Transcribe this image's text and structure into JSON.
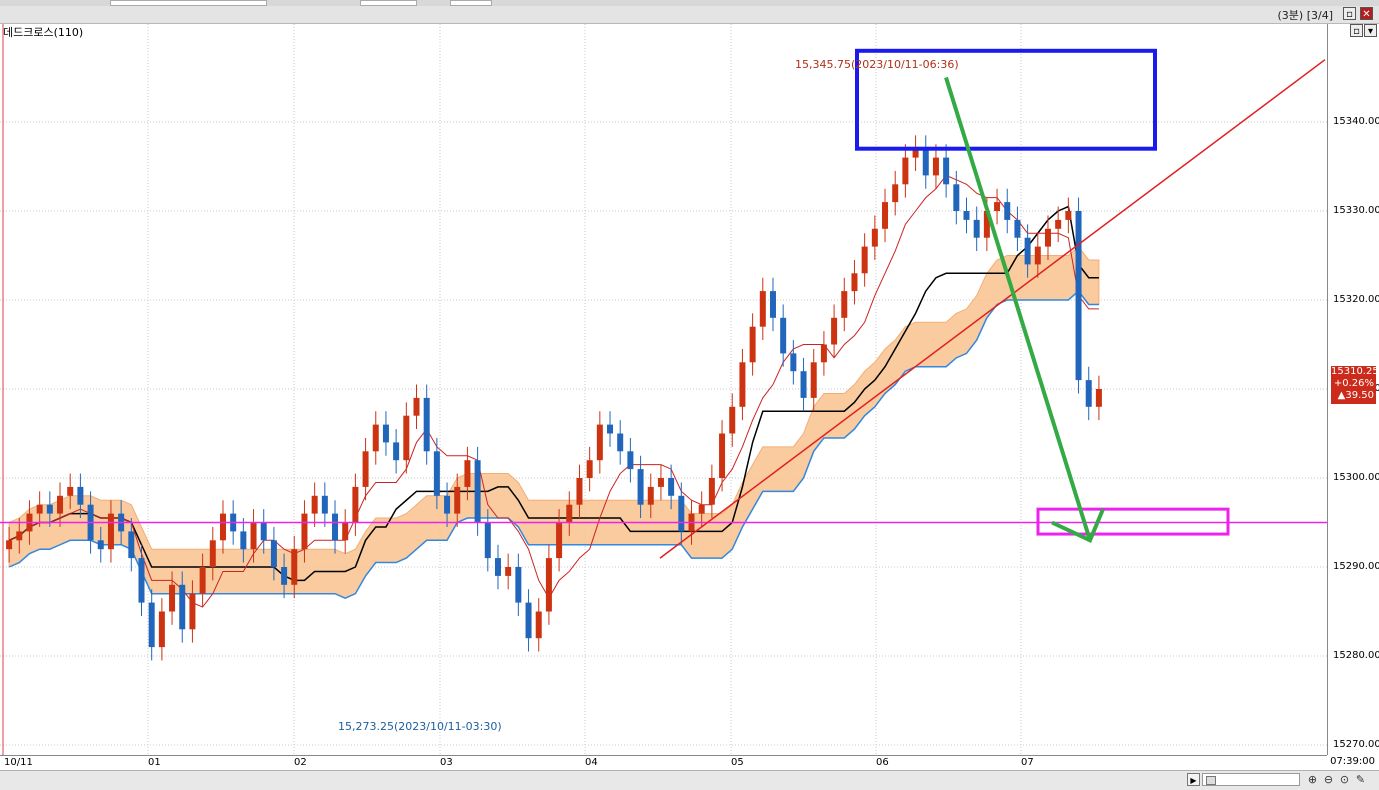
{
  "window": {
    "title": "(3분) [3/4]",
    "restore_glyph": "▫",
    "close_glyph": "✕"
  },
  "chart_data": {
    "type": "candlestick",
    "indicator_label": "데드크로스(110)",
    "y_ticks": [
      "15270.00",
      "15280.00",
      "15290.00",
      "15300.00",
      "15310.00",
      "15320.00",
      "15330.00",
      "15340.00"
    ],
    "ylim": [
      15270,
      15350
    ],
    "x_ticks": [
      "10/11",
      "01",
      "02",
      "03",
      "04",
      "05",
      "06",
      "07"
    ],
    "high_annotation": "15,345.75(2023/10/11-06:36)",
    "low_annotation": "15,273.25(2023/10/11-03:30)",
    "current_price": "15310.25",
    "change_percent": "+0.26%",
    "change_points": "▲39.50",
    "horizontal_line_level": 15295,
    "up_color": "#cc3311",
    "down_color": "#2266bb",
    "closes": [
      15293,
      15294,
      15296,
      15297,
      15296,
      15298,
      15299,
      15297,
      15293,
      15292,
      15296,
      15294,
      15291,
      15286,
      15281,
      15285,
      15288,
      15283,
      15287,
      15290,
      15293,
      15296,
      15294,
      15292,
      15295,
      15293,
      15290,
      15288,
      15292,
      15296,
      15298,
      15296,
      15293,
      15295,
      15299,
      15303,
      15306,
      15304,
      15302,
      15307,
      15309,
      15303,
      15298,
      15296,
      15299,
      15302,
      15295,
      15291,
      15289,
      15290,
      15286,
      15282,
      15285,
      15291,
      15295,
      15297,
      15300,
      15302,
      15306,
      15305,
      15303,
      15301,
      15297,
      15299,
      15300,
      15298,
      15294,
      15296,
      15297,
      15300,
      15305,
      15308,
      15313,
      15317,
      15321,
      15318,
      15314,
      15312,
      15309,
      15313,
      15315,
      15318,
      15321,
      15323,
      15326,
      15328,
      15331,
      15333,
      15336,
      15337,
      15334,
      15336,
      15333,
      15330,
      15329,
      15327,
      15330,
      15331,
      15329,
      15327,
      15324,
      15326,
      15328,
      15329,
      15330,
      15311,
      15308,
      15310
    ]
  },
  "bottom": {
    "time": "07:39:00",
    "scroll_right": "▶",
    "zoom_in_icon": "⊕",
    "zoom_out_icon": "⊖",
    "search_icon": "⊙",
    "settings_icon": "✎"
  }
}
